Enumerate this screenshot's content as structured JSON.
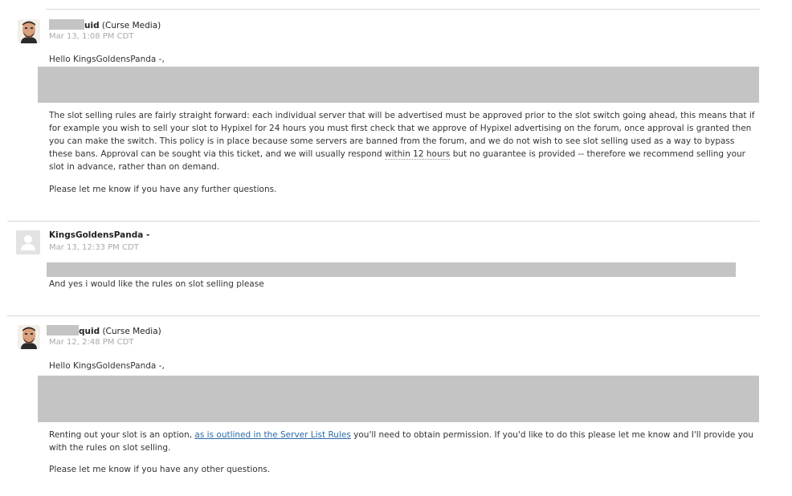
{
  "messages": [
    {
      "author_suffix": "uid",
      "org": " (Curse Media)",
      "timestamp": "Mar 13, 1:08 PM CDT",
      "greeting": "Hello KingsGoldensPanda -,",
      "body_before": "The slot selling rules are fairly straight forward: each individual server that will be advertised must be approved prior to the slot switch going ahead, this means that if for example you wish to sell your slot to Hypixel for 24 hours you must first check that we approve of Hypixel advertising on the forum, once approval is granted then you can make the switch. This policy is in place because some servers are banned from the forum, and we do not wish to see slot selling used as a way to bypass these bans. Approval can be sought via this ticket, and we will usually respond ",
      "body_highlight": "within 12 hours",
      "body_after": " but no guarantee is provided -- therefore we recommend selling your slot in advance, rather than on demand.",
      "closing": "Please let me know if you have any further questions."
    },
    {
      "author": "KingsGoldensPanda -",
      "timestamp": "Mar 13, 12:33 PM CDT",
      "body": "And yes i would like the rules on slot selling please"
    },
    {
      "author_suffix": "quid",
      "org": " (Curse Media)",
      "timestamp": "Mar 12, 2:48 PM CDT",
      "greeting": "Hello KingsGoldensPanda -,",
      "body_before": "Renting out your slot is an option, ",
      "link_text": "as is outlined in the Server List Rules",
      "body_after": " you'll need to obtain permission. If you'd like to do this please let me know and I'll provide you with the rules on slot selling.",
      "closing": "Please let me know if you have any other questions."
    }
  ],
  "icons": {
    "staff_avatar": "staff-avatar-icon",
    "user_avatar": "default-user-avatar-icon"
  },
  "colors": {
    "redaction": "#c4c4c4",
    "link": "#2b6aa8",
    "timestamp": "#aaaaaa"
  }
}
